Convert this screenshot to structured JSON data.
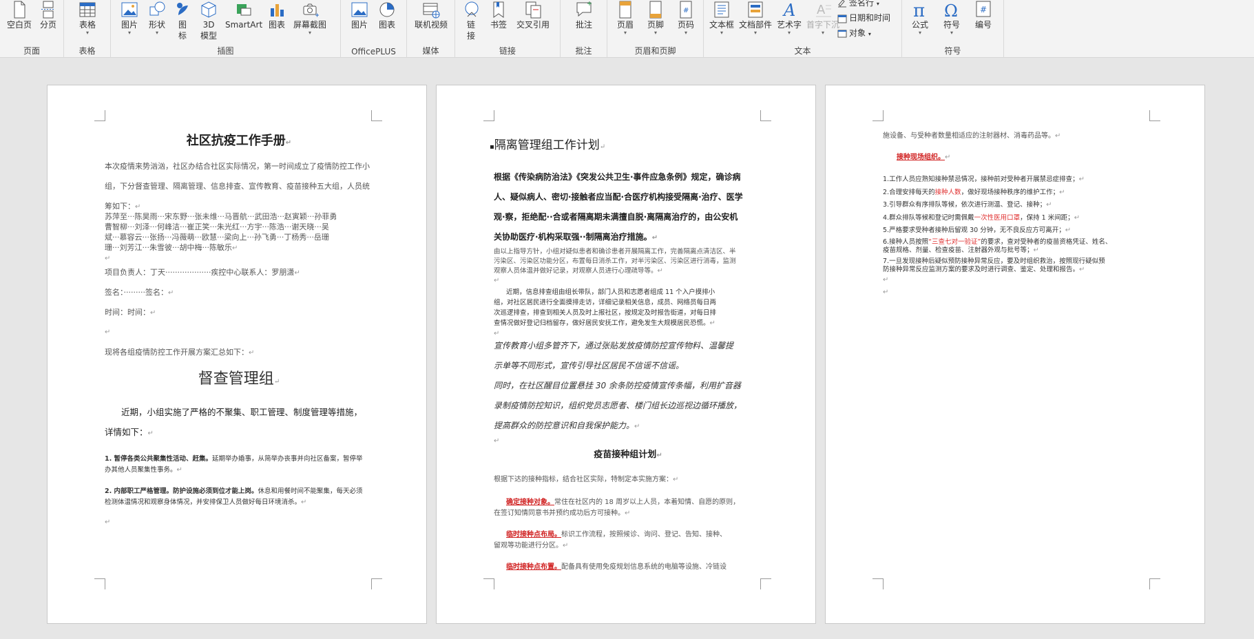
{
  "ribbon": {
    "page_group": {
      "label": "页面",
      "blank_page": "空白页",
      "page_break": "分页"
    },
    "table_group": {
      "label": "表格",
      "table": "表格"
    },
    "illustrations_group": {
      "label": "插图",
      "pictures": "图片",
      "shapes": "形状",
      "icons": "图标",
      "models_3d": "3D 模型",
      "smartart": "SmartArt",
      "chart": "图表",
      "screenshot": "屏幕截图"
    },
    "officeplus_group": {
      "label": "OfficePLUS",
      "pictures": "图片",
      "charts": "图表"
    },
    "media_group": {
      "label": "媒体",
      "online_video": "联机视频"
    },
    "links_group": {
      "label": "链接",
      "link": "链接",
      "bookmark": "书签",
      "cross_reference": "交叉引用"
    },
    "comments_group": {
      "label": "批注",
      "comment": "批注"
    },
    "header_footer_group": {
      "label": "页眉和页脚",
      "header": "页眉",
      "footer": "页脚",
      "page_number": "页码"
    },
    "text_group": {
      "label": "文本",
      "text_box": "文本框",
      "quick_parts": "文档部件",
      "wordart": "艺术字",
      "drop_cap": "首字下沉",
      "signature_line": "签名行",
      "date_time": "日期和时间",
      "object": "对象"
    },
    "symbols_group": {
      "label": "符号",
      "equation": "公式",
      "symbol": "符号",
      "number": "编号"
    }
  },
  "colors": {
    "ribbon_bg": "#f3f3f3",
    "canvas_bg": "#e6e6e6",
    "accent_blue": "#2b6cc4",
    "red_text": "#e03030"
  },
  "page1": {
    "title": "社区抗疫工作手册",
    "intro1": "本次疫情来势汹汹，社区办结合社区实际情况，第一时间成立了疫情防控工作小",
    "intro2": "组，下分督查管理、隔离管理、信息排查、宣传教育、疫苗接种五大组，人员统",
    "intro3": "筹如下：",
    "names1": "苏萍至···陈昊雨···宋东野···张未维···马晋航···武田浩···赵寅颖···孙菲勇",
    "names2": "曹智柳···刘泽···何峰洁···崔正笑···朱光红···方宇···陈浩···谢天晓···吴",
    "names3": "斌···慕容云···张扬···冯薇萌···欧慧···梁向上···孙飞勇···丁杨秀···岳珊",
    "names4": "珊···刘芳江···朱雪彼···胡中梅···陈敏乐",
    "leader": "项目负责人：丁天···················疾控中心联系人：罗朋潇",
    "sign": "签名：·········签名：",
    "time": "时间：时间：",
    "summary": "现将各组疫情防控工作开展方案汇总如下：",
    "section": "督查管理组",
    "para1": "近期，小组实施了严格的不聚集、职工管理、制度管理等措施，",
    "para2": "详情如下：",
    "item1_bold": "1. 暂停各类公共聚集性活动、赶集。",
    "item1_a": "延期举办婚事，从简举办丧事并向社区备案，暂停举",
    "item1_b": "办其他人员聚集性事务。",
    "item2_bold": "2. 内部职工严格管理。防护设施必须到位才能上岗。",
    "item2_a": "休息和用餐时间不能聚集，每天必须",
    "item2_b": "检测体温情况和观察身体情况，并安排保卫人员做好每日环境消杀。"
  },
  "page2": {
    "title": "隔离管理组工作计划",
    "bold1": "根据《传染病防治法》《突发公共卫生·事件应急条例》规定，确诊病",
    "bold2": "人、疑似病人、密切·接触者应当配·合医疗机构接受隔离·治疗、医学",
    "bold3": "观·察，拒绝配··合或者隔离期未满擅自脱·离隔离治疗的，由公安机",
    "bold4": "关协助医疗·机构采取强··制隔离治疗措施。",
    "small1": "由以上指导方针，小组对疑似患者和确诊患者开展隔离工作，完善隔离点清洁区、半",
    "small2": "污染区、污染区功能分区，布置每日消杀工作，对半污染区、污染区进行消毒，监测",
    "small3": "观察人员体温并做好记录，对观察人员进行心理疏导等。",
    "info1": "近期，信息排查组由组长带队，部门人员和志愿者组成 11 个入户摸排小",
    "info2": "组，对社区居民进行全面摸排走访，详细记录相关信息，成员、网络员每日两",
    "info3": "次巡逻排查，排查到相关人员及时上报社区，按规定及时报告街道，对每日排",
    "info4": "查情况做好登记归档留存，做好居民安抚工作，避免发生大规模居民恐慌。",
    "prop1": "宣传教育小组多管齐下，通过张贴发放疫情防控宣传物料、温馨提",
    "prop2": "示单等不同形式，宣传引导社区居民不信谣不信谣。",
    "prop3": "同时，在社区醒目位置悬挂 30 余条防控疫情宣传条幅，利用扩音器",
    "prop4": "录制疫情防控知识，组织党员志愿者、楼门组长边巡视边循环播放，",
    "prop5": "提高群众的防控意识和自我保护能力。",
    "vaccine_title": "疫苗接种组计划",
    "vaccine_intro": "根据下达的接种指标，结合社区实际，特制定本实施方案：",
    "v1_label": "确定接种对象。",
    "v1_a": "常住在社区内的 18 周岁以上人员，本着知情、自愿的原则，",
    "v1_b": "在签订知情同意书并预约成功后方可接种。",
    "v2_label": "临时接种点布局。",
    "v2_a": "标识工作流程，按照候诊、询问、登记、告知、接种、",
    "v2_b": "留观等功能进行分区。",
    "v3_label": "临时接种点布置。",
    "v3_a": "配备具有使用免疫规划信息系统的电脑等设施、冷链设"
  },
  "page3": {
    "cont": "施设备、与受种者数量相适应的注射器材、消毒药品等。",
    "onsite": "接种现场组织。",
    "r1": "1.工作人员应熟知接种禁忌情况，接种前对受种者开展禁忌症排查；",
    "r2_a": "2.合理安排每天的",
    "r2_red": "接种人数",
    "r2_b": "，做好现场接种秩序的维护工作；",
    "r3": "3.引导群众有序排队等候，依次进行测温、登记、接种；",
    "r4_a": "4.群众排队等候和登记时需佩戴",
    "r4_red": "一次性医用口罩",
    "r4_b": "，保持 1 米间距；",
    "r5": "5.严格要求受种者接种后留观 30 分钟，无不良反应方可离开；",
    "r6_a": "6.接种人员按照",
    "r6_red": "“三查七对一验证”",
    "r6_b": "的要求，查对受种者的疫苗资格凭证、姓名、",
    "r6_c": "疫苗规格、剂量、检查疫苗、注射器外观与批号等；",
    "r7_a": "7.一旦发现接种后疑似预防接种异常反应，要及时组织救治，按照现行疑似预",
    "r7_b": "防接种异常反应监测方案的要求及时进行调查、鉴定、处理和报告。"
  }
}
